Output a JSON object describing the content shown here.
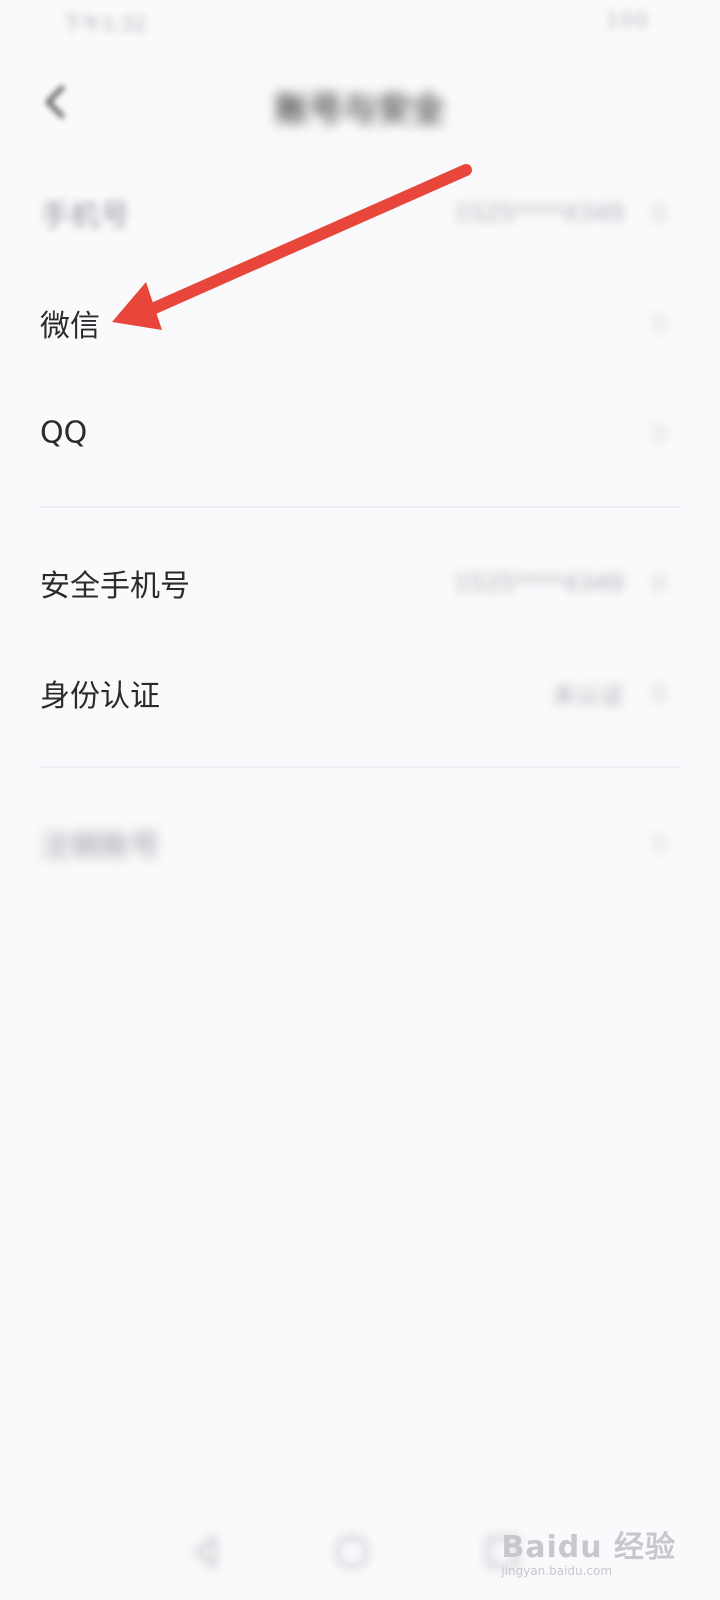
{
  "status_bar": {
    "left_text": "下午1:32",
    "right_text": "100"
  },
  "header": {
    "title": "账号与安全"
  },
  "rows": [
    {
      "label": "手机号",
      "value": "1525****4349"
    },
    {
      "label": "微信",
      "value": ""
    },
    {
      "label": "QQ",
      "value": ""
    },
    {
      "label": "安全手机号",
      "value": "1525****4349"
    },
    {
      "label": "身份认证",
      "value": "未认证"
    },
    {
      "label": "注销账号",
      "value": ""
    }
  ],
  "watermark": {
    "brand": "Baidu 经验",
    "url": "jingyan.baidu.com"
  },
  "colors": {
    "arrow": "#e8463a",
    "background": "#fafafc"
  },
  "icons": [
    "back-arrow-icon",
    "chevron-right-icon",
    "nav-back-icon",
    "nav-home-icon",
    "nav-recent-icon"
  ]
}
